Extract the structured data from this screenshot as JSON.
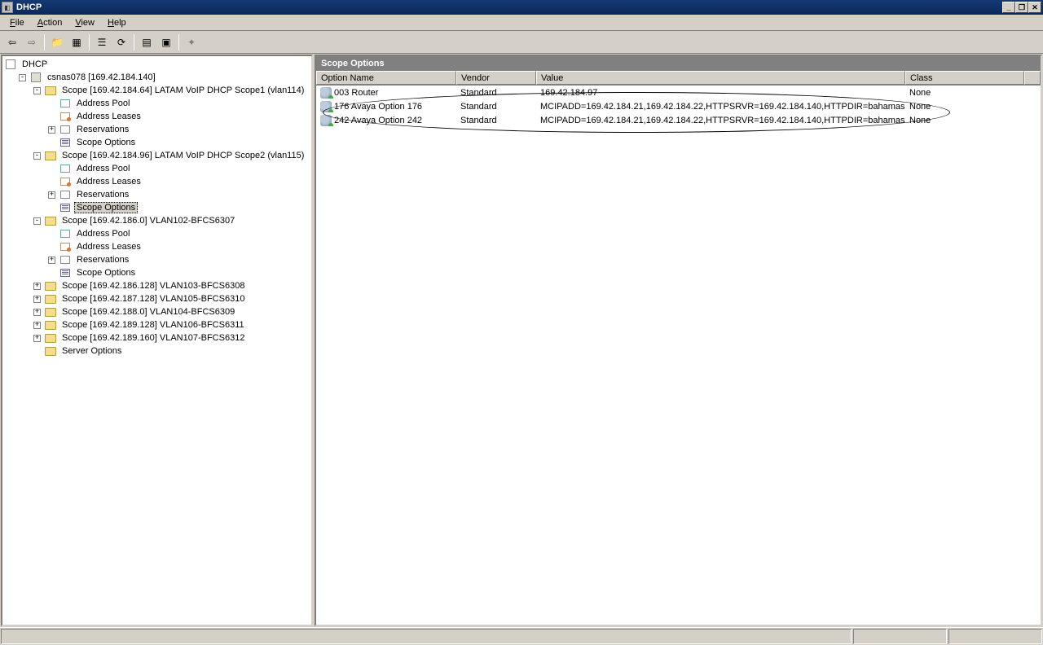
{
  "window": {
    "title": "DHCP"
  },
  "menu": {
    "file": "File",
    "action": "Action",
    "view": "View",
    "help": "Help"
  },
  "detail_header": "Scope Options",
  "columns": {
    "name": "Option Name",
    "vendor": "Vendor",
    "value": "Value",
    "class": "Class"
  },
  "tree": {
    "root": "DHCP",
    "server": "csnas078 [169.42.184.140]",
    "scope1": "Scope [169.42.184.64] LATAM VoIP DHCP Scope1 (vlan114)",
    "scope2": "Scope [169.42.184.96] LATAM VoIP DHCP Scope2 (vlan115)",
    "scope3": "Scope [169.42.186.0] VLAN102-BFCS6307",
    "scope4": "Scope [169.42.186.128] VLAN103-BFCS6308",
    "scope5": "Scope [169.42.187.128] VLAN105-BFCS6310",
    "scope6": "Scope [169.42.188.0] VLAN104-BFCS6309",
    "scope7": "Scope [169.42.189.128] VLAN106-BFCS6311",
    "scope8": "Scope [169.42.189.160] VLAN107-BFCS6312",
    "pool": "Address Pool",
    "leases": "Address Leases",
    "reservations": "Reservations",
    "scope_options": "Scope Options",
    "server_options": "Server Options"
  },
  "rows": [
    {
      "name": "003 Router",
      "vendor": "Standard",
      "value": "169.42.184.97",
      "class": "None"
    },
    {
      "name": "176 Avaya Option 176",
      "vendor": "Standard",
      "value": "MCIPADD=169.42.184.21,169.42.184.22,HTTPSRVR=169.42.184.140,HTTPDIR=bahamas",
      "class": "None"
    },
    {
      "name": "242 Avaya Option 242",
      "vendor": "Standard",
      "value": "MCIPADD=169.42.184.21,169.42.184.22,HTTPSRVR=169.42.184.140,HTTPDIR=bahamas",
      "class": "None"
    }
  ]
}
